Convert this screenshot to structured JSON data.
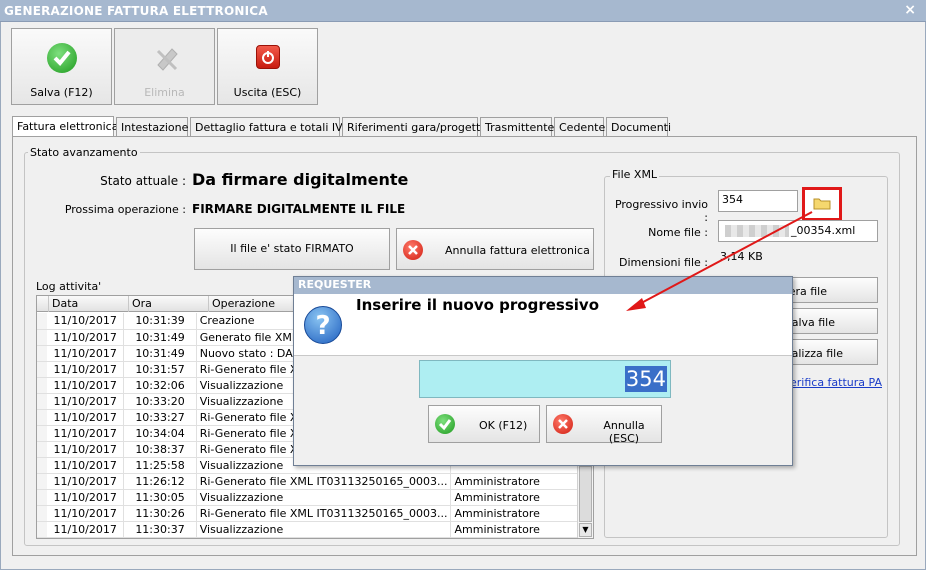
{
  "window": {
    "title": "GENERAZIONE FATTURA ELETTRONICA",
    "close_glyph": "×"
  },
  "toolbar": {
    "save": "Salva (F12)",
    "delete": "Elimina",
    "exit": "Uscita (ESC)"
  },
  "tabs": [
    "Fattura elettronica",
    "Intestazione",
    "Dettaglio fattura e totali IVA",
    "Riferimenti gara/progetto",
    "Trasmittente",
    "Cedente",
    "Documenti"
  ],
  "status": {
    "group_label": "Stato avanzamento",
    "current_label": "Stato attuale :",
    "current_value": "Da firmare digitalmente",
    "next_label": "Prossima operazione :",
    "next_value": "FIRMARE DIGITALMENTE IL FILE",
    "signed_btn": "Il file e' stato FIRMATO",
    "cancel_btn": "Annulla fattura elettronica"
  },
  "log": {
    "label": "Log attivita'",
    "columns": [
      "Data",
      "Ora",
      "Operazione"
    ],
    "rows": [
      [
        "11/10/2017",
        "10:31:39",
        "Creazione",
        ""
      ],
      [
        "11/10/2017",
        "10:31:49",
        "Generato file XML",
        ""
      ],
      [
        "11/10/2017",
        "10:31:49",
        "Nuovo stato : DA",
        ""
      ],
      [
        "11/10/2017",
        "10:31:57",
        "Ri-Generato file X",
        ""
      ],
      [
        "11/10/2017",
        "10:32:06",
        "Visualizzazione",
        ""
      ],
      [
        "11/10/2017",
        "10:33:20",
        "Visualizzazione",
        ""
      ],
      [
        "11/10/2017",
        "10:33:27",
        "Ri-Generato file X",
        ""
      ],
      [
        "11/10/2017",
        "10:34:04",
        "Ri-Generato file X",
        ""
      ],
      [
        "11/10/2017",
        "10:38:37",
        "Ri-Generato file X",
        ""
      ],
      [
        "11/10/2017",
        "11:25:58",
        "Visualizzazione",
        ""
      ],
      [
        "11/10/2017",
        "11:26:12",
        "Ri-Generato file XML IT03113250165_0003...",
        "Amministratore"
      ],
      [
        "11/10/2017",
        "11:30:05",
        "Visualizzazione",
        "Amministratore"
      ],
      [
        "11/10/2017",
        "11:30:26",
        "Ri-Generato file XML IT03113250165_0003...",
        "Amministratore"
      ],
      [
        "11/10/2017",
        "11:30:37",
        "Visualizzazione",
        "Amministratore"
      ]
    ]
  },
  "xml": {
    "group_label": "File XML",
    "prog_label": "Progressivo invio :",
    "prog_value": "354",
    "name_label": "Nome file :",
    "name_value": "_00354.xml",
    "size_label": "Dimensioni file :",
    "size_value": "3,14 KB",
    "btn_generate": "era file",
    "btn_save": "Salva file",
    "btn_view": "sualizza file",
    "link_verify": "erifica fattura PA"
  },
  "dialog": {
    "title": "REQUESTER",
    "message": "Inserire il nuovo progressivo",
    "input_value": "354",
    "ok": "OK (F12)",
    "cancel": "Annulla (ESC)"
  },
  "colors": {
    "accent": "#a6b8cf",
    "highlight": "#e01818",
    "input_bg": "#aeeef2"
  }
}
